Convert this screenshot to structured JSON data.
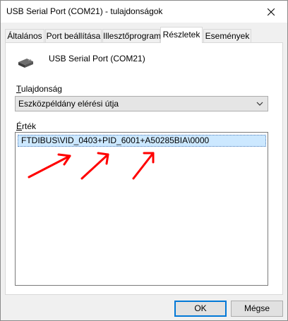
{
  "window": {
    "title": "USB Serial Port (COM21) - tulajdonságok"
  },
  "tabs": [
    {
      "label": "Általános"
    },
    {
      "label": "Port beállítása"
    },
    {
      "label": "Illesztőprogram"
    },
    {
      "label": "Részletek",
      "active": true
    },
    {
      "label": "Események"
    }
  ],
  "device": {
    "name": "USB Serial Port (COM21)"
  },
  "property": {
    "label_underlined": "T",
    "label_rest": "ulajdonság",
    "selected": "Eszközpéldány elérési útja"
  },
  "value": {
    "label_underlined": "É",
    "label_rest": "rték",
    "items": [
      "FTDIBUS\\VID_0403+PID_6001+A50285BIA\\0000"
    ]
  },
  "buttons": {
    "ok": "OK",
    "cancel": "Mégse"
  },
  "colors": {
    "annotation_arrows": "#ff0000",
    "selection_bg": "#cce8ff",
    "default_button_border": "#0078d7"
  }
}
